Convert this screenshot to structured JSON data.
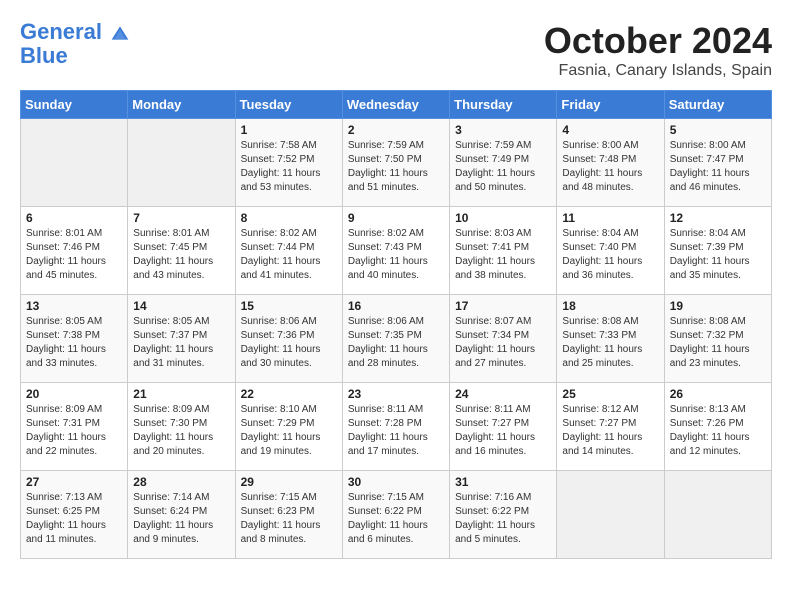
{
  "header": {
    "logo_line1": "General",
    "logo_line2": "Blue",
    "month": "October 2024",
    "location": "Fasnia, Canary Islands, Spain"
  },
  "weekdays": [
    "Sunday",
    "Monday",
    "Tuesday",
    "Wednesday",
    "Thursday",
    "Friday",
    "Saturday"
  ],
  "weeks": [
    [
      {
        "day": "",
        "info": ""
      },
      {
        "day": "",
        "info": ""
      },
      {
        "day": "1",
        "info": "Sunrise: 7:58 AM\nSunset: 7:52 PM\nDaylight: 11 hours and 53 minutes."
      },
      {
        "day": "2",
        "info": "Sunrise: 7:59 AM\nSunset: 7:50 PM\nDaylight: 11 hours and 51 minutes."
      },
      {
        "day": "3",
        "info": "Sunrise: 7:59 AM\nSunset: 7:49 PM\nDaylight: 11 hours and 50 minutes."
      },
      {
        "day": "4",
        "info": "Sunrise: 8:00 AM\nSunset: 7:48 PM\nDaylight: 11 hours and 48 minutes."
      },
      {
        "day": "5",
        "info": "Sunrise: 8:00 AM\nSunset: 7:47 PM\nDaylight: 11 hours and 46 minutes."
      }
    ],
    [
      {
        "day": "6",
        "info": "Sunrise: 8:01 AM\nSunset: 7:46 PM\nDaylight: 11 hours and 45 minutes."
      },
      {
        "day": "7",
        "info": "Sunrise: 8:01 AM\nSunset: 7:45 PM\nDaylight: 11 hours and 43 minutes."
      },
      {
        "day": "8",
        "info": "Sunrise: 8:02 AM\nSunset: 7:44 PM\nDaylight: 11 hours and 41 minutes."
      },
      {
        "day": "9",
        "info": "Sunrise: 8:02 AM\nSunset: 7:43 PM\nDaylight: 11 hours and 40 minutes."
      },
      {
        "day": "10",
        "info": "Sunrise: 8:03 AM\nSunset: 7:41 PM\nDaylight: 11 hours and 38 minutes."
      },
      {
        "day": "11",
        "info": "Sunrise: 8:04 AM\nSunset: 7:40 PM\nDaylight: 11 hours and 36 minutes."
      },
      {
        "day": "12",
        "info": "Sunrise: 8:04 AM\nSunset: 7:39 PM\nDaylight: 11 hours and 35 minutes."
      }
    ],
    [
      {
        "day": "13",
        "info": "Sunrise: 8:05 AM\nSunset: 7:38 PM\nDaylight: 11 hours and 33 minutes."
      },
      {
        "day": "14",
        "info": "Sunrise: 8:05 AM\nSunset: 7:37 PM\nDaylight: 11 hours and 31 minutes."
      },
      {
        "day": "15",
        "info": "Sunrise: 8:06 AM\nSunset: 7:36 PM\nDaylight: 11 hours and 30 minutes."
      },
      {
        "day": "16",
        "info": "Sunrise: 8:06 AM\nSunset: 7:35 PM\nDaylight: 11 hours and 28 minutes."
      },
      {
        "day": "17",
        "info": "Sunrise: 8:07 AM\nSunset: 7:34 PM\nDaylight: 11 hours and 27 minutes."
      },
      {
        "day": "18",
        "info": "Sunrise: 8:08 AM\nSunset: 7:33 PM\nDaylight: 11 hours and 25 minutes."
      },
      {
        "day": "19",
        "info": "Sunrise: 8:08 AM\nSunset: 7:32 PM\nDaylight: 11 hours and 23 minutes."
      }
    ],
    [
      {
        "day": "20",
        "info": "Sunrise: 8:09 AM\nSunset: 7:31 PM\nDaylight: 11 hours and 22 minutes."
      },
      {
        "day": "21",
        "info": "Sunrise: 8:09 AM\nSunset: 7:30 PM\nDaylight: 11 hours and 20 minutes."
      },
      {
        "day": "22",
        "info": "Sunrise: 8:10 AM\nSunset: 7:29 PM\nDaylight: 11 hours and 19 minutes."
      },
      {
        "day": "23",
        "info": "Sunrise: 8:11 AM\nSunset: 7:28 PM\nDaylight: 11 hours and 17 minutes."
      },
      {
        "day": "24",
        "info": "Sunrise: 8:11 AM\nSunset: 7:27 PM\nDaylight: 11 hours and 16 minutes."
      },
      {
        "day": "25",
        "info": "Sunrise: 8:12 AM\nSunset: 7:27 PM\nDaylight: 11 hours and 14 minutes."
      },
      {
        "day": "26",
        "info": "Sunrise: 8:13 AM\nSunset: 7:26 PM\nDaylight: 11 hours and 12 minutes."
      }
    ],
    [
      {
        "day": "27",
        "info": "Sunrise: 7:13 AM\nSunset: 6:25 PM\nDaylight: 11 hours and 11 minutes."
      },
      {
        "day": "28",
        "info": "Sunrise: 7:14 AM\nSunset: 6:24 PM\nDaylight: 11 hours and 9 minutes."
      },
      {
        "day": "29",
        "info": "Sunrise: 7:15 AM\nSunset: 6:23 PM\nDaylight: 11 hours and 8 minutes."
      },
      {
        "day": "30",
        "info": "Sunrise: 7:15 AM\nSunset: 6:22 PM\nDaylight: 11 hours and 6 minutes."
      },
      {
        "day": "31",
        "info": "Sunrise: 7:16 AM\nSunset: 6:22 PM\nDaylight: 11 hours and 5 minutes."
      },
      {
        "day": "",
        "info": ""
      },
      {
        "day": "",
        "info": ""
      }
    ]
  ]
}
